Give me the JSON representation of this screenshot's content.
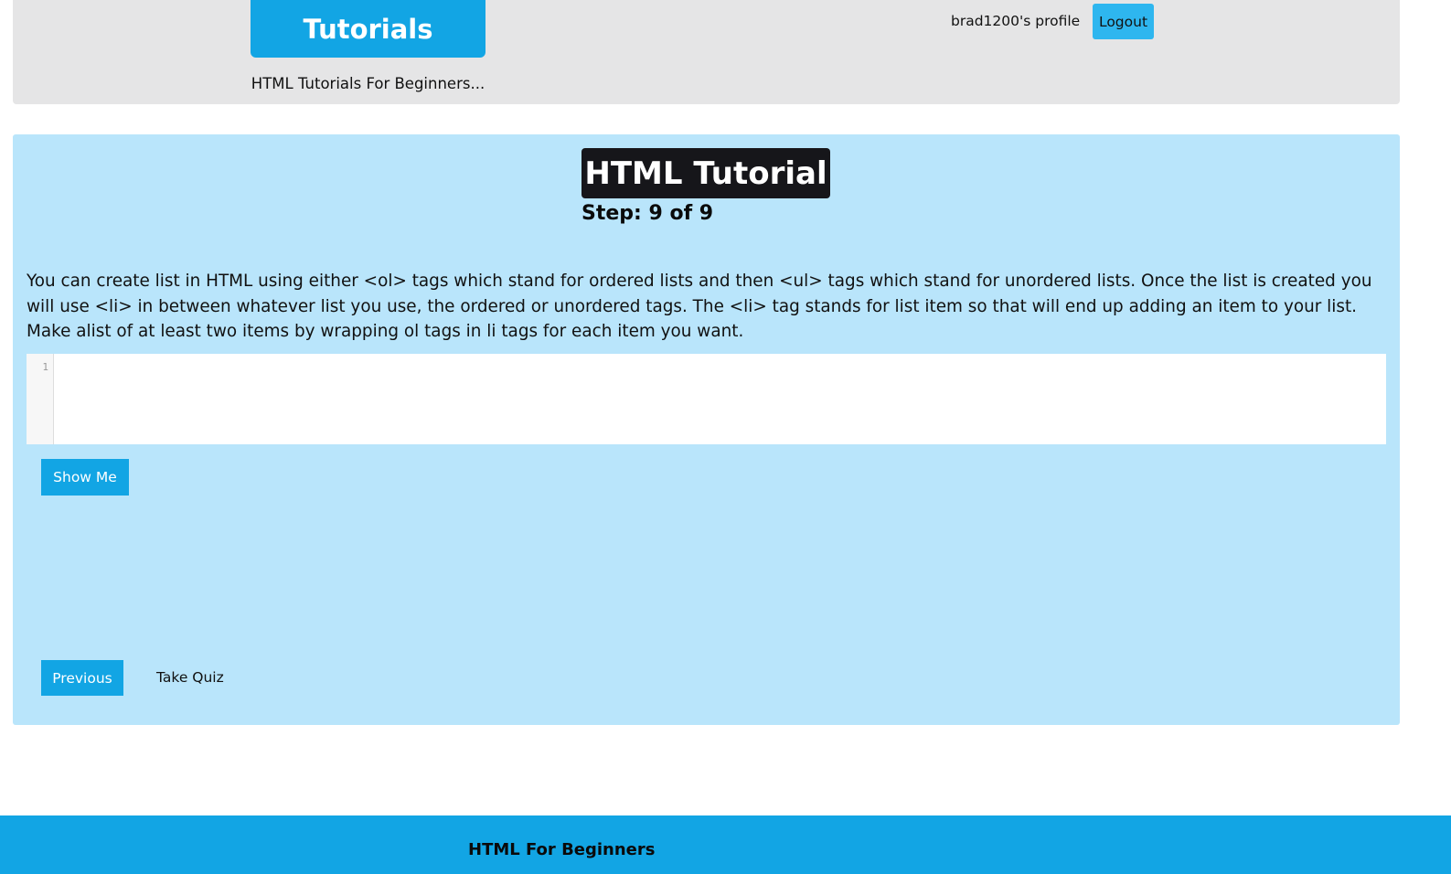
{
  "header": {
    "brand_label": "Tutorials",
    "brand_subtitle": "HTML Tutorials For Beginners...",
    "profile_label": "brad1200's profile",
    "logout_label": "Logout"
  },
  "tutorial": {
    "title": "HTML Tutorial",
    "step_text": "Step: 9 of 9",
    "instructions": "You can create list in HTML using either <ol> tags which stand for ordered lists and then <ul> tags which stand for unordered lists. Once the list is created you will use <li> in between whatever list you use, the ordered or unordered tags. The <li> tag stands for list item so that will end up adding an item to your list. Make alist of at least two items by wrapping ol tags in li tags for each item you want.",
    "editor": {
      "line_number": "1",
      "value": ""
    },
    "show_me_label": "Show Me",
    "previous_label": "Previous",
    "take_quiz_label": "Take Quiz"
  },
  "footer": {
    "title": "HTML For Beginners"
  },
  "colors": {
    "header_bg": "#e5e5e6",
    "accent": "#12a5e4",
    "logout_bg": "#2eb6ef",
    "panel_bg": "#b9e5fb",
    "title_bg": "#16161a"
  }
}
